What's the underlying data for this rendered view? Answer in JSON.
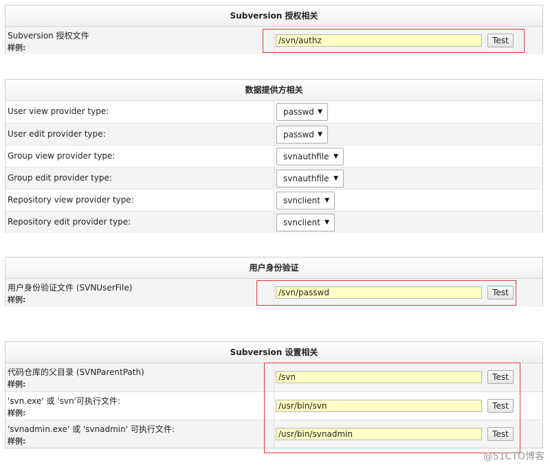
{
  "auth_section": {
    "title": "Subversion 授权相关",
    "row": {
      "label": "Subversion 授权文件",
      "sample": "样例:",
      "value": "/svn/authz",
      "button": "Test"
    }
  },
  "provider_section": {
    "title": "数据提供方相关",
    "rows": [
      {
        "label": "User view provider type:",
        "value": "passwd"
      },
      {
        "label": "User edit provider type:",
        "value": "passwd"
      },
      {
        "label": "Group view provider type:",
        "value": "svnauthfile"
      },
      {
        "label": "Group edit provider type:",
        "value": "svnauthfile"
      },
      {
        "label": "Repository view provider type:",
        "value": "svnclient"
      },
      {
        "label": "Repository edit provider type:",
        "value": "svnclient"
      }
    ],
    "dropdown_icon": "triangle-down"
  },
  "user_auth_section": {
    "title": "用户身份验证",
    "row": {
      "label": "用户身份验证文件 (SVNUserFile)",
      "sample": "样例:",
      "value": "/svn/passwd",
      "button": "Test"
    }
  },
  "svn_settings_section": {
    "title": "Subversion 设置相关",
    "rows": [
      {
        "label": "代码仓库的父目录 (SVNParentPath)",
        "sample": "样例:",
        "value": "/svn",
        "button": "Test"
      },
      {
        "label": "'svn.exe' 或 'svn'可执行文件:",
        "sample": "样例:",
        "value": "/usr/bin/svn",
        "button": "Test"
      },
      {
        "label": "'svnadmin.exe' 或 'svnadmin' 可执行文件:",
        "sample": "样例:",
        "value": "/usr/bin/svnadmin",
        "button": "Test"
      }
    ]
  },
  "annotation_color": "#e0393e",
  "watermark": "@51CTO博客"
}
